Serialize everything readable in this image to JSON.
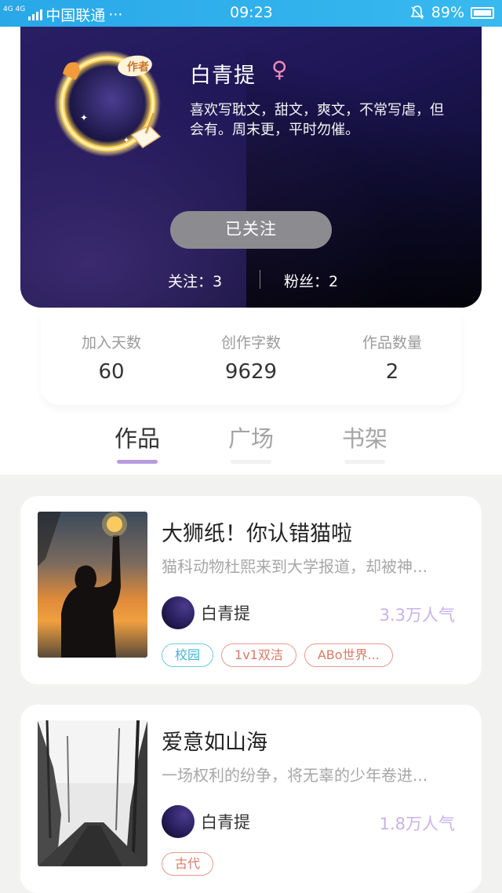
{
  "status_bar": {
    "network": "4G 4G",
    "carrier": "中国联通",
    "dots": "···",
    "time": "09:23",
    "battery": "89%"
  },
  "profile": {
    "badge": "作者",
    "name": "白青提",
    "gender_symbol": "♀",
    "bio": "喜欢写耽文，甜文，爽文，不常写虐，但会有。周末更，平时勿催。",
    "follow_button": "已关注",
    "following": "关注：3",
    "fans": "粉丝：2"
  },
  "stats": [
    {
      "label": "加入天数",
      "value": "60"
    },
    {
      "label": "创作字数",
      "value": "9629"
    },
    {
      "label": "作品数量",
      "value": "2"
    }
  ],
  "tabs": [
    {
      "label": "作品",
      "active": true
    },
    {
      "label": "广场",
      "active": false
    },
    {
      "label": "书架",
      "active": false
    }
  ],
  "works": [
    {
      "title": "大狮纸！你认错猫啦",
      "description": "猫科动物杜熙来到大学报道，却被神...",
      "author": "白青提",
      "popularity": "3.3万人气",
      "tags": [
        "校园",
        "1v1双洁",
        "ABo世界..."
      ]
    },
    {
      "title": "爱意如山海",
      "description": "一场权利的纷争，将无辜的少年卷进...",
      "author": "白青提",
      "popularity": "1.8万人气",
      "tags": [
        "古代"
      ]
    }
  ],
  "colors": {
    "status_bar": "#38b9ef",
    "accent_purple": "#b99be0",
    "popularity": "#c8b2ea",
    "tag_red": "#e89a8c",
    "tag_blue": "#6cc9e4"
  }
}
